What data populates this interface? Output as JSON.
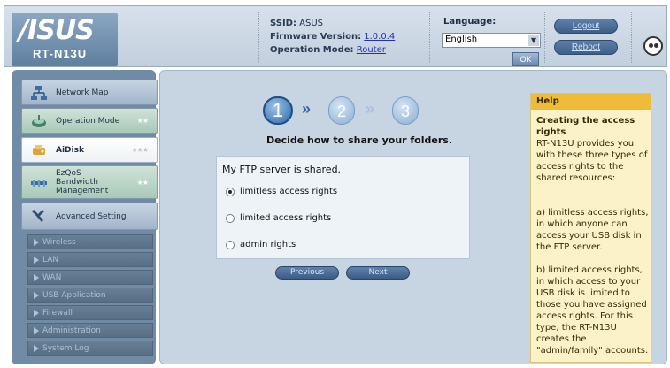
{
  "header": {
    "logo": "/ISUS",
    "model": "RT-N13U",
    "ssid_label": "SSID:",
    "ssid_value": "ASUS",
    "firmware_label": "Firmware Version:",
    "firmware_value": "1.0.0.4",
    "opmode_label": "Operation Mode:",
    "opmode_value": "Router",
    "language_label": "Language:",
    "language_value": "English",
    "ok_label": "OK",
    "logout_label": "Logout",
    "reboot_label": "Reboot"
  },
  "sidebar": {
    "items": [
      {
        "label": "Network Map",
        "icon": "network-map-icon"
      },
      {
        "label": "Operation Mode",
        "icon": "operation-mode-icon",
        "stars": "★★"
      },
      {
        "label": "AiDisk",
        "icon": "aidisk-icon",
        "stars": "★★★"
      },
      {
        "label_line1": "EzQoS",
        "label_line2": "Bandwidth",
        "label_line3": "Management",
        "icon": "ezqos-icon",
        "stars": "★★"
      },
      {
        "label": "Advanced Setting",
        "icon": "wrench-icon"
      }
    ],
    "sub_items": [
      "Wireless",
      "LAN",
      "WAN",
      "USB Application",
      "Firewall",
      "Administration",
      "System Log"
    ]
  },
  "wizard": {
    "steps": [
      "1",
      "2",
      "3"
    ],
    "current_step": 1,
    "question": "Decide how to share your folders.",
    "panel_title": "My FTP server is shared.",
    "options": [
      "limitless access rights",
      "limited access rights",
      "admin rights"
    ],
    "selected_option": 0,
    "previous_label": "Previous",
    "next_label": "Next"
  },
  "help": {
    "header": "Help",
    "title": "Creating the access rights",
    "p1": "RT-N13U provides you with these three types of access rights to the shared resources:",
    "p2": "a) limitless access rights, in which anyone can access your USB disk in the FTP server.",
    "p3": "b) limited access rights, in which access to your USB disk is limited to those you have assigned access rights. For this type, the RT-N13U creates the \"admin/family\" accounts."
  },
  "colors": {
    "sidebar_bg": "#6f8ba6",
    "main_bg": "#c7d4e1",
    "help_bg": "#fbf2c8",
    "help_header": "#eebc3a"
  }
}
